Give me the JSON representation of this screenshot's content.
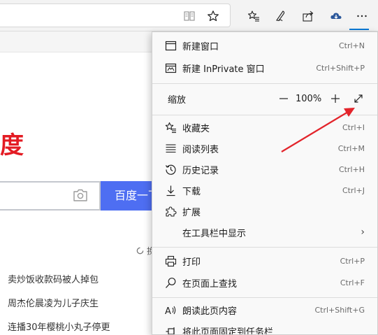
{
  "browser": {
    "toolbar_icons": [
      "reading-view-icon",
      "favorite-star-icon",
      "favorites-list-icon",
      "pen-icon",
      "share-icon",
      "cloud-icon",
      "more-icon"
    ]
  },
  "page": {
    "logo_text": "度",
    "search_button_label": "百度一下",
    "loading_char": "换",
    "hot_items": [
      "卖炒饭收款码被人掉包",
      "周杰伦晨凌为儿子庆生",
      "连播30年樱桃小丸子停更"
    ]
  },
  "menu": {
    "items_top": [
      {
        "label": "新建窗口",
        "shortcut": "Ctrl+N",
        "icon": "window-icon"
      },
      {
        "label": "新建 InPrivate 窗口",
        "shortcut": "Ctrl+Shift+P",
        "icon": "inprivate-icon"
      }
    ],
    "zoom": {
      "label": "缩放",
      "minus": "—",
      "value": "100%",
      "plus": "+",
      "fullscreen_icon": "fullscreen-icon"
    },
    "items_mid": [
      {
        "label": "收藏夹",
        "shortcut": "Ctrl+I",
        "icon": "favorites-icon"
      },
      {
        "label": "阅读列表",
        "shortcut": "Ctrl+M",
        "icon": "reading-list-icon"
      },
      {
        "label": "历史记录",
        "shortcut": "Ctrl+H",
        "icon": "history-icon"
      },
      {
        "label": "下载",
        "shortcut": "Ctrl+J",
        "icon": "download-icon"
      },
      {
        "label": "扩展",
        "shortcut": "",
        "icon": "extensions-icon"
      },
      {
        "label": "在工具栏中显示",
        "shortcut": "",
        "icon": "",
        "chevron": "›"
      }
    ],
    "items_bottom": [
      {
        "label": "打印",
        "shortcut": "Ctrl+P",
        "icon": "print-icon"
      },
      {
        "label": "在页面上查找",
        "shortcut": "Ctrl+F",
        "icon": "find-icon"
      },
      {
        "label": "朗读此页内容",
        "shortcut": "Ctrl+Shift+G",
        "icon": "read-aloud-icon"
      },
      {
        "label": "将此页面固定到任务栏",
        "shortcut": "",
        "icon": "pin-icon"
      }
    ]
  },
  "colors": {
    "accent": "#0078d4",
    "annotation_arrow": "#e3242b",
    "baidu_red": "#e31b23",
    "baidu_blue": "#4e6ef2"
  }
}
